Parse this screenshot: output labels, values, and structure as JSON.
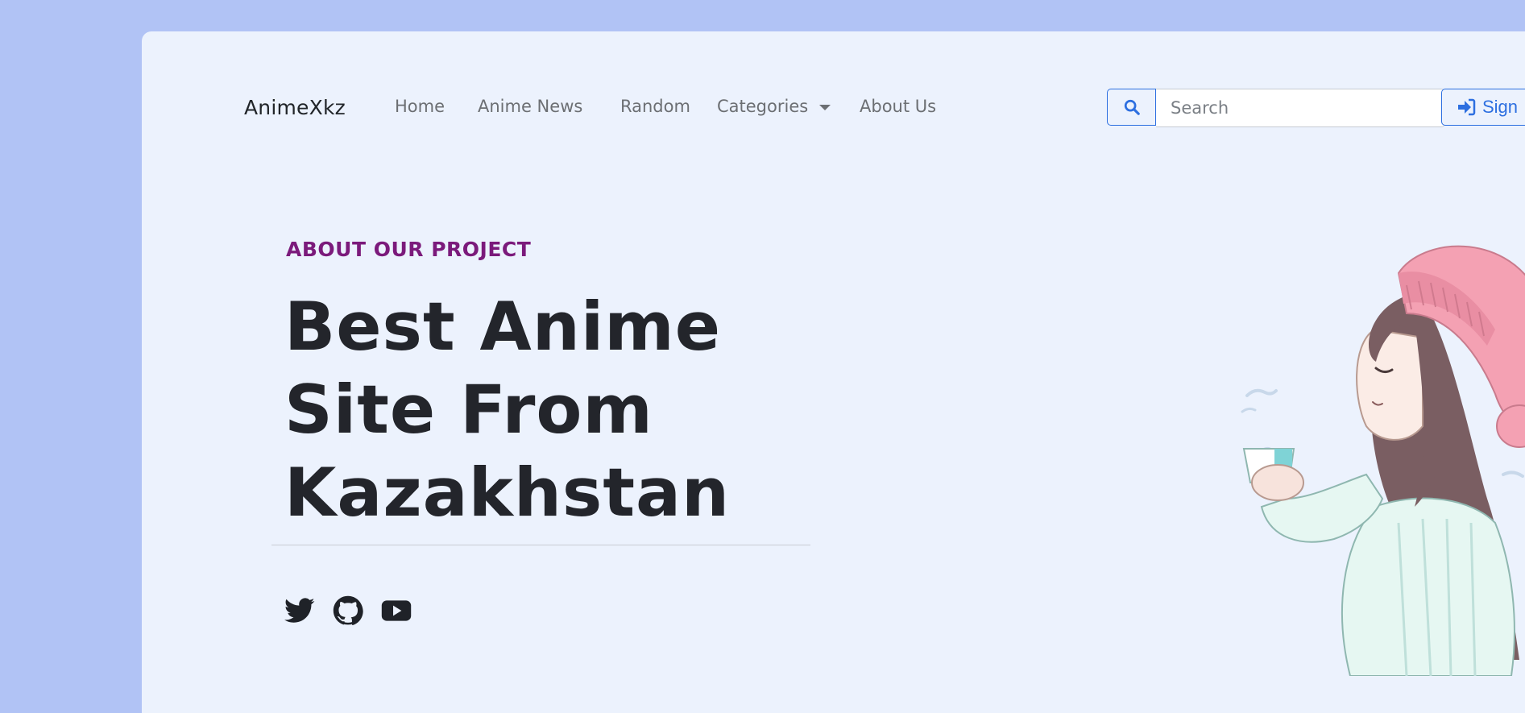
{
  "navbar": {
    "brand": "AnimeXkz",
    "links": {
      "home": "Home",
      "news": "Anime News",
      "random": "Random",
      "categories": "Categories",
      "about": "About Us"
    },
    "search": {
      "placeholder": "Search",
      "value": ""
    },
    "signin_label": "Sign"
  },
  "hero": {
    "eyebrow": "ABOUT OUR PROJECT",
    "headline_lines": [
      "Best Anime",
      "Site From",
      "Kazakhstan"
    ]
  },
  "socials": [
    "twitter-icon",
    "github-icon",
    "youtube-icon"
  ],
  "colors": {
    "page_background": "#b1c3f5",
    "card_background": "#ecf2fd",
    "accent_blue": "#2d6fe0",
    "eyebrow_purple": "#7b1a7b",
    "headline_text": "#23252b"
  }
}
